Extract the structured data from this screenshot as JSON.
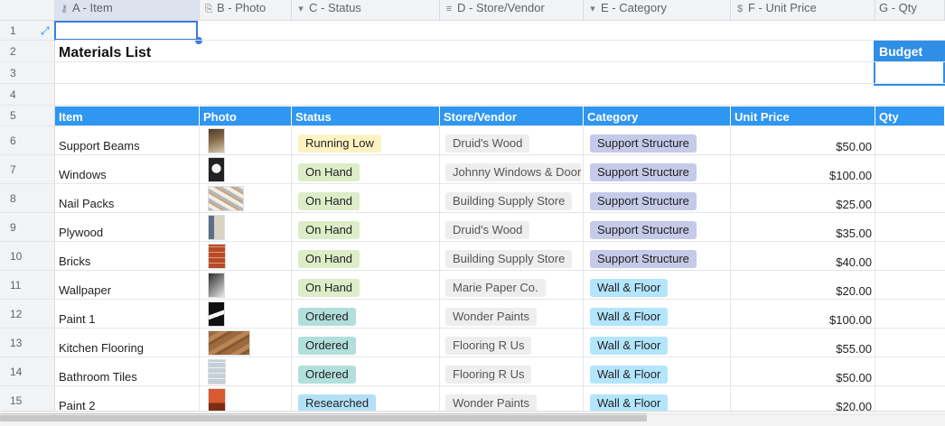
{
  "columns": [
    {
      "icon": "key-icon",
      "glyph": "⚷",
      "label": "A - Item"
    },
    {
      "icon": "paperclip-icon",
      "glyph": "⎘",
      "label": "B - Photo"
    },
    {
      "icon": "dropdown-icon",
      "glyph": "▾",
      "label": "C - Status"
    },
    {
      "icon": "database-icon",
      "glyph": "≡",
      "label": "D - Store/Vendor"
    },
    {
      "icon": "dropdown-icon",
      "glyph": "▾",
      "label": "E - Category"
    },
    {
      "icon": "dollar-icon",
      "glyph": "$",
      "label": "F - Unit Price"
    },
    {
      "icon": "",
      "glyph": "",
      "label": "G - Qty"
    }
  ],
  "row_numbers": [
    "1",
    "2",
    "3",
    "4",
    "5",
    "6",
    "7",
    "8",
    "9",
    "10",
    "11",
    "12",
    "13",
    "14",
    "15"
  ],
  "sheet_title": "Materials List",
  "budget_label": "Budget",
  "table_headers": [
    "Item",
    "Photo",
    "Status",
    "Store/Vendor",
    "Category",
    "Unit Price",
    "Qty"
  ],
  "colors": {
    "header_blue": "#2f96f1",
    "status": {
      "Running Low": "#fdf3c2",
      "On Hand": "#dcedc8",
      "Ordered": "#b2dfdb",
      "Researched": "#b3e0f7"
    },
    "vendor_bg": "#eeeeee",
    "category": {
      "Support Structure": "#c5cae9",
      "Wall & Floor": "#b3e5fc"
    }
  },
  "rows": [
    {
      "item": "Support Beams",
      "photo": "beam-photo",
      "status": "Running Low",
      "vendor": "Druid's Wood",
      "category": "Support Structure",
      "price": "$50.00"
    },
    {
      "item": "Windows",
      "photo": "window-photo",
      "status": "On Hand",
      "vendor": "Johnny Windows & Doors",
      "category": "Support Structure",
      "price": "$100.00"
    },
    {
      "item": "Nail Packs",
      "photo": "nails-photo",
      "status": "On Hand",
      "vendor": "Building Supply Store",
      "category": "Support Structure",
      "price": "$25.00"
    },
    {
      "item": "Plywood",
      "photo": "plywood-photo",
      "status": "On Hand",
      "vendor": "Druid's Wood",
      "category": "Support Structure",
      "price": "$35.00"
    },
    {
      "item": "Bricks",
      "photo": "bricks-photo",
      "status": "On Hand",
      "vendor": "Building Supply Store",
      "category": "Support Structure",
      "price": "$40.00"
    },
    {
      "item": "Wallpaper",
      "photo": "wallpaper-photo",
      "status": "On Hand",
      "vendor": "Marie Paper Co.",
      "category": "Wall & Floor",
      "price": "$20.00"
    },
    {
      "item": "Paint 1",
      "photo": "paint-photo",
      "status": "Ordered",
      "vendor": "Wonder Paints",
      "category": "Wall & Floor",
      "price": "$100.00"
    },
    {
      "item": "Kitchen Flooring",
      "photo": "flooring-photo",
      "status": "Ordered",
      "vendor": "Flooring R Us",
      "category": "Wall & Floor",
      "price": "$55.00"
    },
    {
      "item": "Bathroom Tiles",
      "photo": "tiles-photo",
      "status": "Ordered",
      "vendor": "Flooring R Us",
      "category": "Wall & Floor",
      "price": "$50.00"
    },
    {
      "item": "Paint 2",
      "photo": "paint2-photo",
      "status": "Researched",
      "vendor": "Wonder Paints",
      "category": "Wall & Floor",
      "price": "$20.00"
    }
  ]
}
